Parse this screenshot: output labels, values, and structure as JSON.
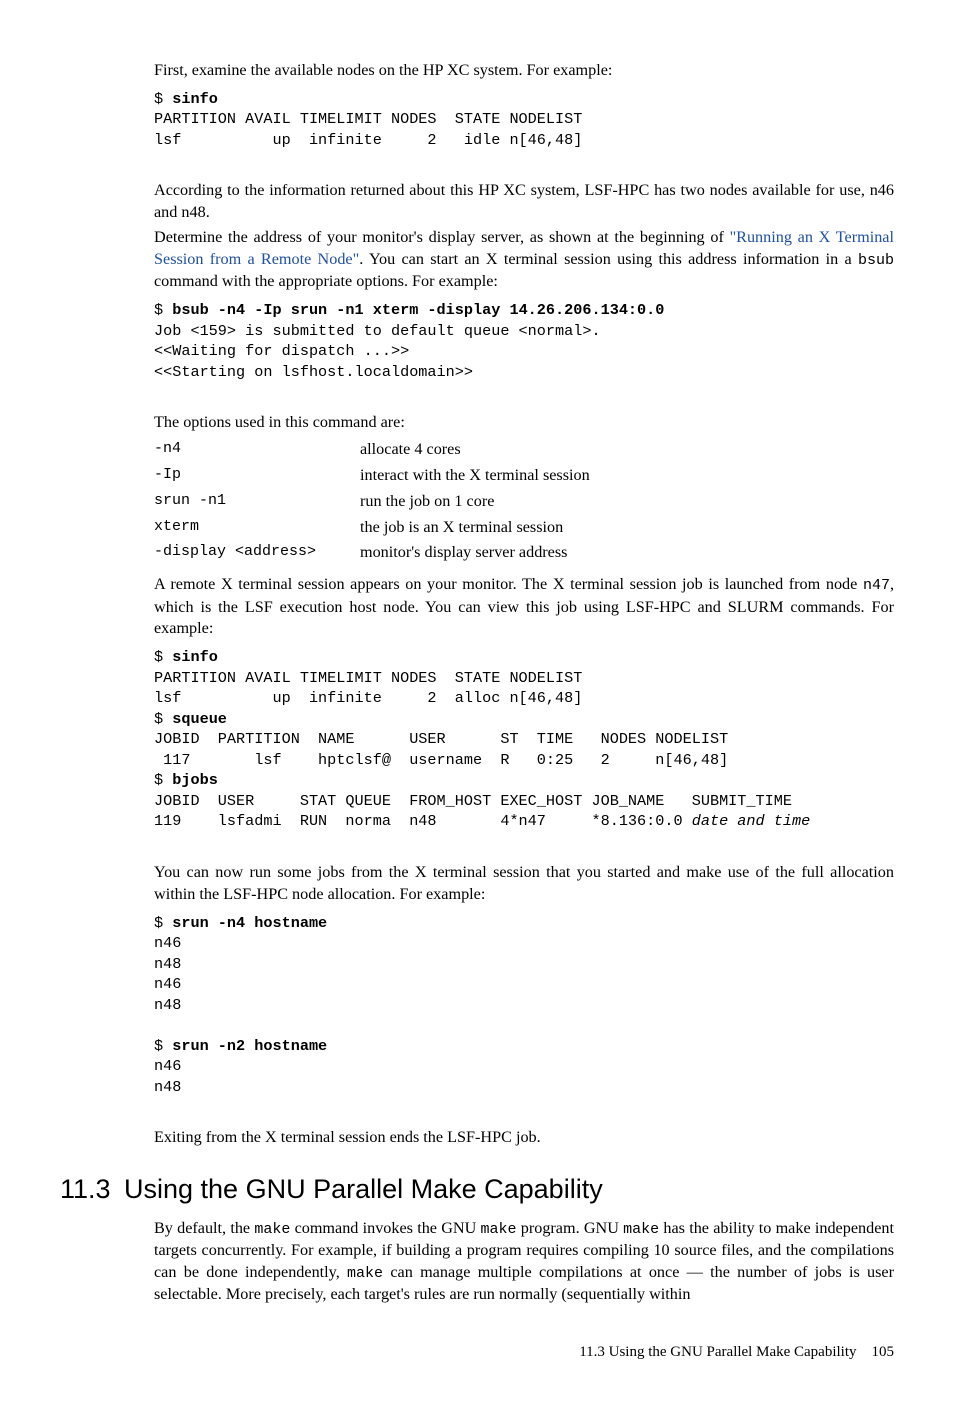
{
  "p1": "First, examine the available nodes on the HP XC system. For example:",
  "code1": {
    "prompt": "$ ",
    "cmd": "sinfo",
    "out": "PARTITION AVAIL TIMELIMIT NODES  STATE NODELIST\nlsf          up  infinite     2   idle n[46,48]"
  },
  "p2": "According to the information returned about this HP XC system, LSF-HPC has two nodes available for use, n46 and n48.",
  "p3a": "Determine the address of your monitor's display server, as shown at the beginning of ",
  "p3link": "\"Running an X Terminal Session from a Remote Node\"",
  "p3b": ". You can start an X terminal session using this address information in a ",
  "p3_bsub": "bsub",
  "p3c": " command with the appropriate options. For example:",
  "code2": {
    "prompt": "$ ",
    "cmd": "bsub -n4 -Ip srun -n1 xterm -display 14.26.206.134:0.0",
    "out": "Job <159> is submitted to default queue <normal>.\n<<Waiting for dispatch ...>>\n<<Starting on lsfhost.localdomain>>"
  },
  "p4": "The options used in this command are:",
  "opts": [
    {
      "opt": "-n4",
      "desc": "allocate 4 cores"
    },
    {
      "opt": "-Ip",
      "desc": "interact with the X terminal session"
    },
    {
      "opt": "srun -n1",
      "desc": "run the job on 1 core"
    },
    {
      "opt": "xterm",
      "desc": "the job is an X terminal session"
    },
    {
      "opt": "-display <address>",
      "desc": "monitor's display server address"
    }
  ],
  "p5a": "A remote X terminal session appears on your monitor. The X terminal session job is launched from node ",
  "p5code": "n47",
  "p5b": ", which is the LSF execution host node. You can view this job using LSF-HPC and SLURM commands. For example:",
  "code3": {
    "l1p": "$ ",
    "l1c": "sinfo",
    "l2": "PARTITION AVAIL TIMELIMIT NODES  STATE NODELIST",
    "l3": "lsf          up  infinite     2  alloc n[46,48]",
    "l4p": "$ ",
    "l4c": "squeue",
    "l5": "JOBID  PARTITION  NAME      USER      ST  TIME   NODES NODELIST",
    "l6": " 117       lsf    hptclsf@  username  R   0:25   2     n[46,48]",
    "l7p": "$ ",
    "l7c": "bjobs",
    "l8": "JOBID  USER     STAT QUEUE  FROM_HOST EXEC_HOST JOB_NAME   SUBMIT_TIME",
    "l9a": "119    lsfadmi  RUN  norma  n48       4*n47     *8.136:0.0 ",
    "l9i": "date and time"
  },
  "p6": "You can now run some jobs from the X terminal session that you started and make use of the full allocation within the LSF-HPC node allocation. For example:",
  "code4": {
    "l1p": "$ ",
    "l1c": "srun -n4 hostname",
    "l2": "n46\nn48\nn46\nn48",
    "l3p": "$ ",
    "l3c": "srun -n2 hostname",
    "l4": "n46\nn48"
  },
  "p7": "Exiting from the X terminal session ends the LSF-HPC job.",
  "section": {
    "num": "11.3",
    "title": "Using the GNU Parallel Make Capability"
  },
  "p8a": "By default, the ",
  "p8c1": "make",
  "p8b": " command invokes the GNU ",
  "p8c2": "make",
  "p8c": " program. GNU ",
  "p8c3": "make",
  "p8d": " has the ability to make independent targets concurrently. For example, if building a program requires compiling 10 source files, and the compilations can be done independently, ",
  "p8c4": "make",
  "p8e": " can manage multiple compilations at once — the number of jobs is user selectable. More precisely, each target's rules are run normally (sequentially within",
  "footer": {
    "text": "11.3 Using the GNU Parallel Make Capability",
    "page": "105"
  }
}
